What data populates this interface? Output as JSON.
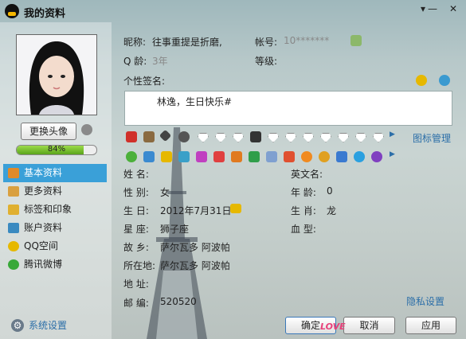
{
  "window": {
    "title": "我的资料",
    "controls": {
      "menu": "▾",
      "minimize": "—",
      "close": "✕"
    }
  },
  "sidebar": {
    "change_avatar_label": "更换头像",
    "completion_percent": 84,
    "completion_label": "84%",
    "items": [
      {
        "label": "基本资料",
        "icon": "profile-card-icon",
        "color": "#e08a2a",
        "active": true
      },
      {
        "label": "更多资料",
        "icon": "more-info-icon",
        "color": "#d9a040",
        "active": false
      },
      {
        "label": "标签和印象",
        "icon": "tag-icon",
        "color": "#e0b030",
        "active": false
      },
      {
        "label": "账户资料",
        "icon": "account-icon",
        "color": "#3a8ac0",
        "active": false
      },
      {
        "label": "QQ空间",
        "icon": "qzone-star-icon",
        "color": "#e6b800",
        "active": false
      },
      {
        "label": "腾讯微博",
        "icon": "weibo-icon",
        "color": "#38a838",
        "active": false
      }
    ],
    "settings_label": "系统设置"
  },
  "profile": {
    "nickname_label": "昵称:",
    "nickname": "往事重提是折磨,",
    "account_label": "帐号:",
    "account_value": "10*******",
    "qage_label": "Q 龄:",
    "qage_value": "3年",
    "level_label": "等级:",
    "signature_label": "个性签名:",
    "signature": "林逸，生日快乐#"
  },
  "badges": {
    "manage_link": "图标管理"
  },
  "details": {
    "name_label": "姓    名:",
    "name_value": "",
    "english_name_label": "英文名:",
    "english_name_value": "",
    "gender_label": "性    别:",
    "gender_value": "女",
    "age_label": "年    龄:",
    "age_value": "0",
    "birthday_label": "生    日:",
    "birthday_value": "2012年7月31日",
    "zodiac_label": "生    肖:",
    "zodiac_value": "龙",
    "constellation_label": "星    座:",
    "constellation_value": "狮子座",
    "blood_label": "血    型:",
    "blood_value": "",
    "hometown_label": "故    乡:",
    "hometown_value": "萨尔瓦多  阿波帕",
    "location_label": "所在地:",
    "location_value": "萨尔瓦多  阿波帕",
    "address_label": "地    址:",
    "address_value": "",
    "postcode_label": "邮    编:",
    "postcode_value": "520520",
    "privacy_link": "隐私设置"
  },
  "buttons": {
    "ok": "确定",
    "cancel": "取消",
    "apply": "应用"
  },
  "decoration_text": "LOVE"
}
